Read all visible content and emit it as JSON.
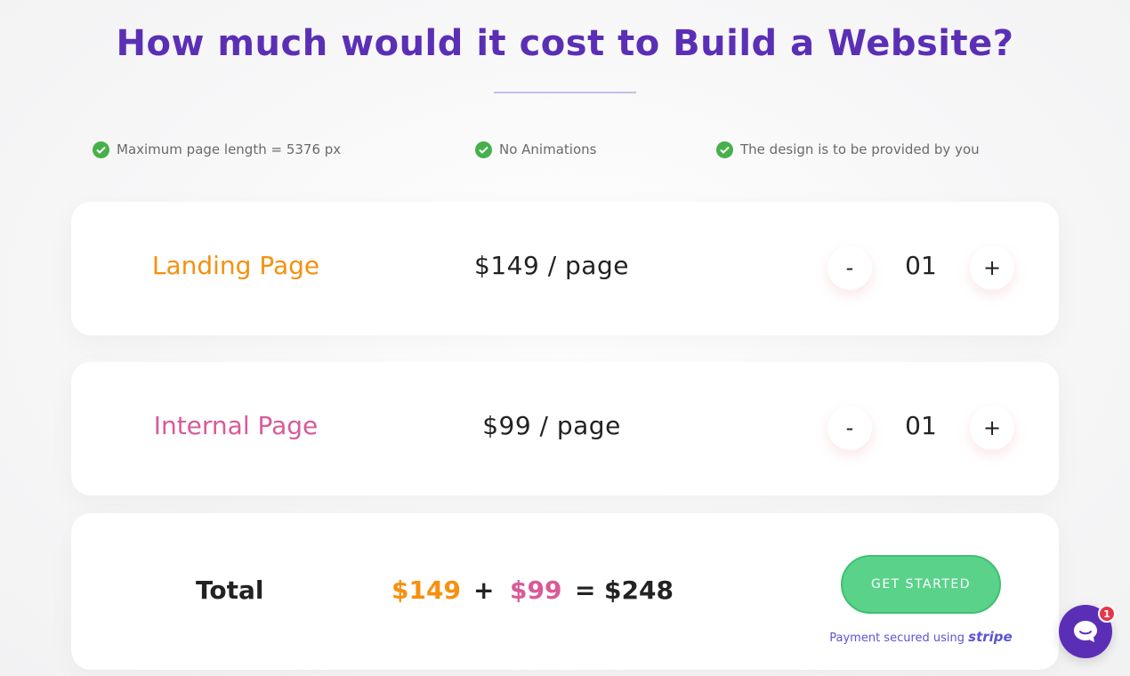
{
  "title": "How much would it cost to Build a Website?",
  "features": [
    {
      "label": "Maximum page length = 5376 px"
    },
    {
      "label": "No Animations"
    },
    {
      "label": "The design is to be provided by you"
    }
  ],
  "rows": [
    {
      "name": "Landing Page",
      "price": "$149 / page",
      "minus": "-",
      "quantity": "01",
      "plus": "+",
      "name_color": "#f7900f"
    },
    {
      "name": "Internal Page",
      "price": "$99 / page",
      "minus": "-",
      "quantity": "01",
      "plus": "+",
      "name_color": "#d95a98"
    }
  ],
  "total": {
    "label": "Total",
    "landing_amount": "$149",
    "plus_sign": "+",
    "internal_amount": "$99",
    "equals_sign": "=",
    "grand_total": "$248"
  },
  "cta": {
    "label": "GET STARTED"
  },
  "payment": {
    "text": "Payment secured using",
    "brand": "stripe"
  },
  "chat": {
    "icon": "chat-bubble-icon",
    "badge_count": "1"
  },
  "colors": {
    "title": "#5b2fb5",
    "landing_accent": "#f7900f",
    "internal_accent": "#d95a98",
    "cta": "#5ad28a",
    "check": "#46b04a",
    "stripe": "#5b55d6"
  }
}
